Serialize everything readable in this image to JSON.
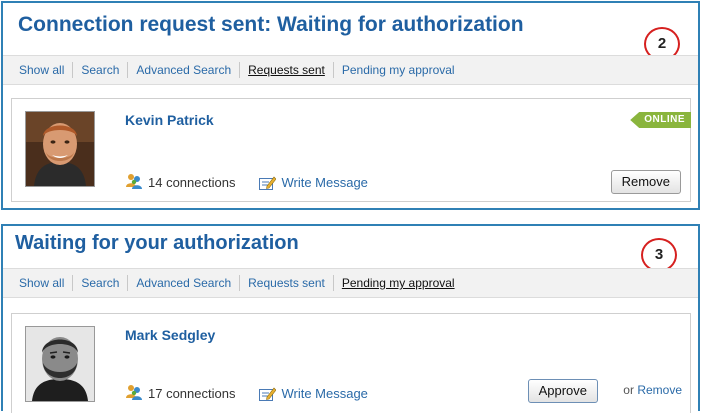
{
  "sent_panel": {
    "title": "Connection request sent: Waiting for authorization",
    "step_number": "2",
    "nav": [
      {
        "label": "Show all",
        "active": false
      },
      {
        "label": "Search",
        "active": false
      },
      {
        "label": "Advanced Search",
        "active": false
      },
      {
        "label": "Requests sent",
        "active": true
      },
      {
        "label": "Pending my approval",
        "active": false
      }
    ],
    "person": {
      "name": "Kevin Patrick",
      "connections": "14 connections",
      "write_message": "Write Message",
      "status": "ONLINE",
      "remove_label": "Remove"
    }
  },
  "pending_panel": {
    "title": "Waiting for your authorization",
    "step_number": "3",
    "nav": [
      {
        "label": "Show all",
        "active": false
      },
      {
        "label": "Search",
        "active": false
      },
      {
        "label": "Advanced Search",
        "active": false
      },
      {
        "label": "Requests sent",
        "active": false
      },
      {
        "label": "Pending my approval",
        "active": true
      }
    ],
    "person": {
      "name": "Mark Sedgley",
      "connections": "17 connections",
      "write_message": "Write Message",
      "approve_label": "Approve",
      "or_text": "or",
      "remove_label": "Remove"
    }
  },
  "colors": {
    "border": "#2f80b5",
    "title": "#1f5fa0",
    "link": "#2a6aa8",
    "online_badge": "#8ab53d",
    "annotation_circle": "#d6201f"
  },
  "icons": {
    "connections": "people-icon",
    "write_message": "compose-icon"
  }
}
